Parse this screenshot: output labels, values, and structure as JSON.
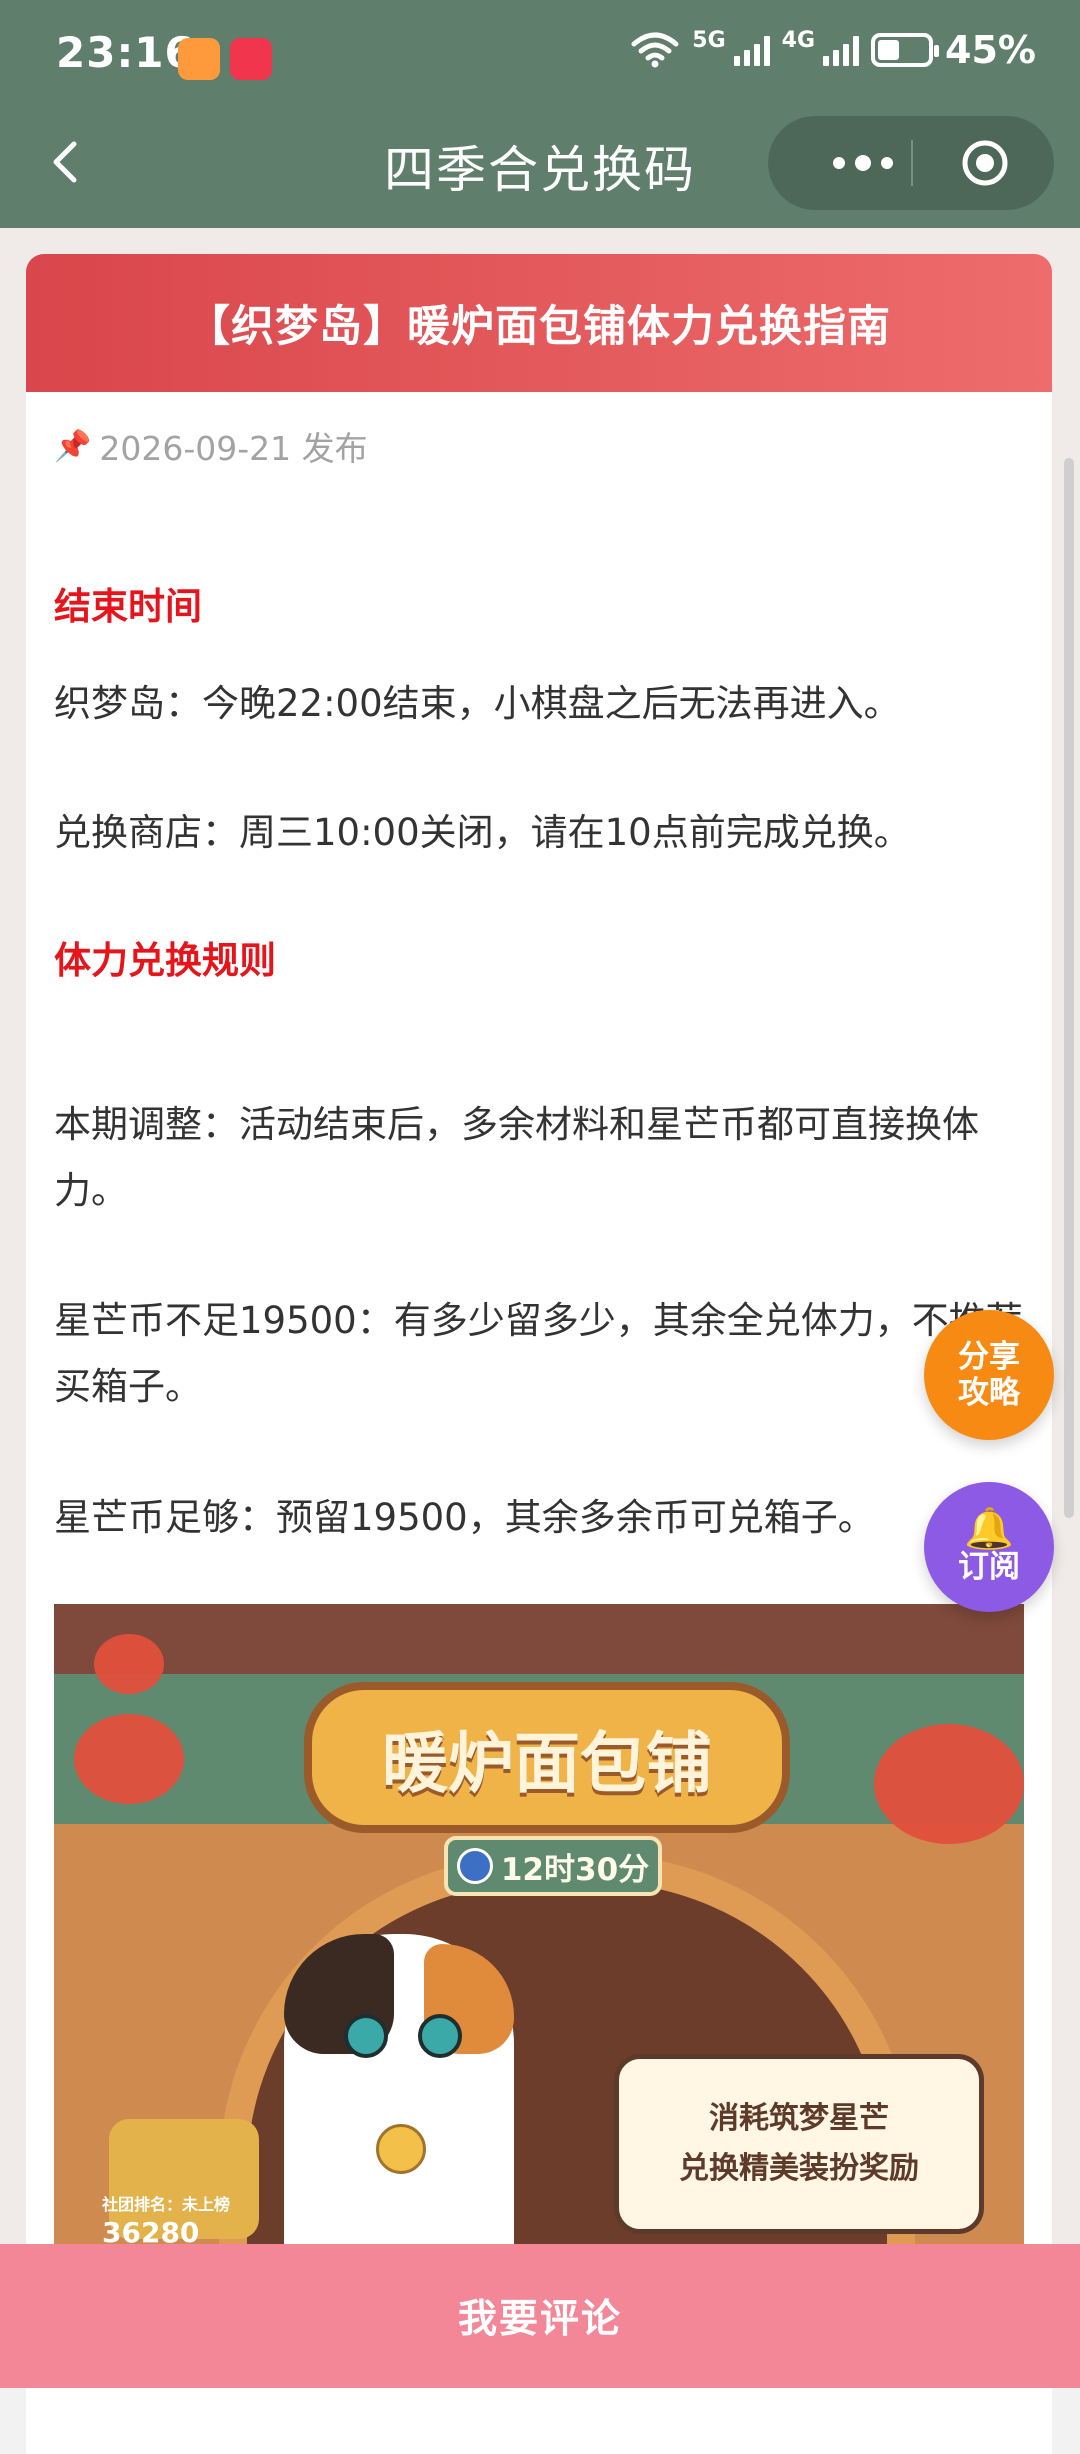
{
  "status_bar": {
    "time": "23:16",
    "signal_5g": "5G",
    "signal_4g": "4G",
    "battery": "45%"
  },
  "nav": {
    "title": "四季合兑换码",
    "icons": [
      "back-icon",
      "more-icon",
      "target-icon"
    ]
  },
  "article": {
    "header": "【织梦岛】暖炉面包铺体力兑换指南",
    "date": "2026-09-21 发布",
    "sections": [
      {
        "title": "结束时间",
        "paragraphs": [
          "织梦岛：今晚22:00结束，小棋盘之后无法再进入。",
          "兑换商店：周三10:00关闭，请在10点前完成兑换。"
        ]
      },
      {
        "title": "体力兑换规则",
        "paragraphs": [
          "本期调整：活动结束后，多余材料和星芒币都可直接换体力。",
          "星芒币不足19500：有多少留多少，其余全兑体力，不推荐买箱子。",
          "星芒币足够：预留19500，其余多余币可兑箱子。"
        ]
      }
    ],
    "hero": {
      "banner": "暖炉面包铺",
      "timer": "12时30分",
      "note_line1": "消耗筑梦星芒",
      "note_line2": "兑换精美装扮奖励",
      "rank_label": "社团排名：未上榜",
      "rank_value": "36280"
    }
  },
  "floating": {
    "share_line1": "分享",
    "share_line2": "攻略",
    "subscribe": "订阅"
  },
  "bottom": {
    "comment": "我要评论"
  },
  "colors": {
    "nav_bg": "#5f7f6c",
    "header_red": "#d9464b",
    "section_red": "#e6141b",
    "share_orange": "#f78a12",
    "subscribe_purple": "#8d5ae6",
    "bottom_pink": "#f38797"
  }
}
